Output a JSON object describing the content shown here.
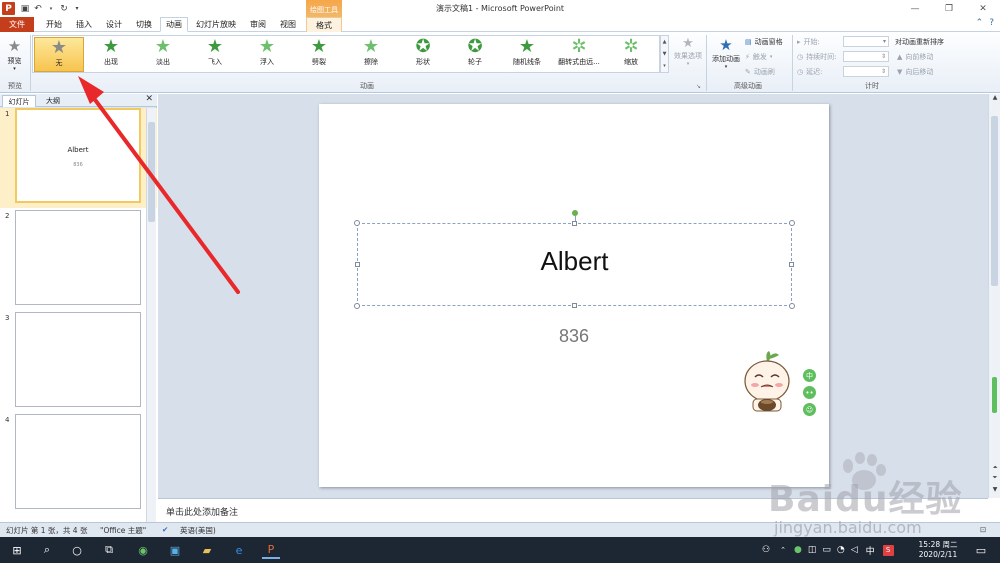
{
  "window": {
    "title": "演示文稿1 - Microsoft PowerPoint",
    "app_icon": "P",
    "contextual_group": "绘图工具"
  },
  "tabs": [
    {
      "label": "文件"
    },
    {
      "label": "开始"
    },
    {
      "label": "插入"
    },
    {
      "label": "设计"
    },
    {
      "label": "切换"
    },
    {
      "label": "动画"
    },
    {
      "label": "幻灯片放映"
    },
    {
      "label": "审阅"
    },
    {
      "label": "视图"
    },
    {
      "label": "格式"
    }
  ],
  "ribbon": {
    "preview": {
      "button": "预览",
      "group": "预览"
    },
    "animation_group_label": "动画",
    "gallery": [
      {
        "label": "无",
        "icon": "star-gray-icon",
        "color": "#8a8a8a"
      },
      {
        "label": "出现",
        "icon": "star-green-icon",
        "color": "#3e9a3e"
      },
      {
        "label": "淡出",
        "icon": "star-green-icon",
        "color": "#5cb85c"
      },
      {
        "label": "飞入",
        "icon": "star-green-icon",
        "color": "#3e9a3e"
      },
      {
        "label": "浮入",
        "icon": "star-green-icon",
        "color": "#5cb85c"
      },
      {
        "label": "劈裂",
        "icon": "star-green-icon",
        "color": "#3e9a3e"
      },
      {
        "label": "擦除",
        "icon": "star-green-icon",
        "color": "#5cb85c"
      },
      {
        "label": "形状",
        "icon": "star-green-icon",
        "color": "#3e9a3e"
      },
      {
        "label": "轮子",
        "icon": "star-green-icon",
        "color": "#3e9a3e"
      },
      {
        "label": "随机线条",
        "icon": "star-green-icon",
        "color": "#3e9a3e"
      },
      {
        "label": "翻转式由远...",
        "icon": "star-green-icon",
        "color": "#5cb85c"
      },
      {
        "label": "缩放",
        "icon": "star-green-icon",
        "color": "#5cb85c"
      }
    ],
    "effect_options": "效果选项",
    "advanced": {
      "group": "高级动画",
      "add_animation": "添加动画",
      "animation_pane": "动画窗格",
      "trigger": "触发",
      "painter": "动画刷"
    },
    "timing": {
      "group": "计时",
      "start": "开始:",
      "duration": "持续时间:",
      "delay": "延迟:",
      "reorder": "对动画重新排序",
      "move_earlier": "向前移动",
      "move_later": "向后移动"
    }
  },
  "left_panel": {
    "tabs": [
      "幻灯片",
      "大纲"
    ],
    "slides": [
      {
        "num": "1",
        "title": "Albert",
        "subtitle": "836"
      },
      {
        "num": "2",
        "title": "",
        "subtitle": ""
      },
      {
        "num": "3",
        "title": "",
        "subtitle": ""
      },
      {
        "num": "4",
        "title": "",
        "subtitle": ""
      }
    ]
  },
  "slide": {
    "title": "Albert",
    "subtitle": "836"
  },
  "side_buttons": [
    "中",
    "••",
    "☺"
  ],
  "notes": {
    "placeholder": "单击此处添加备注"
  },
  "status": {
    "slide_info": "幻灯片 第 1 张，共 4 张",
    "theme": "\"Office 主题\"",
    "language": "英语(美国)"
  },
  "taskbar": {
    "time": "15:28 周二",
    "date": "2020/2/11",
    "ime": "中"
  },
  "watermark": {
    "brand": "Baidu经验",
    "url": "jingyan.baidu.com"
  }
}
